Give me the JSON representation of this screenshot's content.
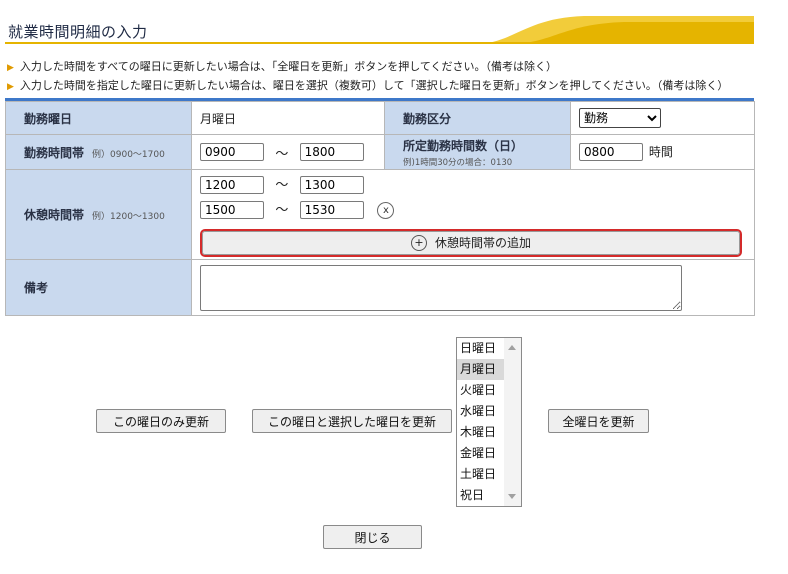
{
  "title": "就業時間明細の入力",
  "notes": [
    "入力した時間をすべての曜日に更新したい場合は、「全曜日を更新」ボタンを押してください。（備考は除く）",
    "入力した時間を指定した曜日に更新したい場合は、曜日を選択（複数可）して「選択した曜日を更新」ボタンを押してください。（備考は除く）"
  ],
  "form": {
    "workday_label": "勤務曜日",
    "workday_value": "月曜日",
    "kubun_label": "勤務区分",
    "kubun_selected": "勤務",
    "worktime_label": "勤務時間帯",
    "worktime_example": "例）0900～1700",
    "worktime_start": "0900",
    "worktime_end": "1800",
    "tilde": "～",
    "prescribed_label": "所定勤務時間数（日）",
    "prescribed_example": "例)1時間30分の場合：0130",
    "prescribed_value": "0800",
    "prescribed_unit": "時間",
    "break_label": "休憩時間帯",
    "break_example": "例）1200～1300",
    "breaks": [
      {
        "start": "1200",
        "end": "1300"
      },
      {
        "start": "1500",
        "end": "1530"
      }
    ],
    "remove_symbol": "x",
    "add_break_label": "休憩時間帯の追加",
    "add_symbol": "+",
    "remarks_label": "備考",
    "remarks_value": ""
  },
  "buttons": {
    "update_this_day": "この曜日のみ更新",
    "update_selected": "この曜日と選択した曜日を更新",
    "update_all": "全曜日を更新",
    "close": "閉じる"
  },
  "weekday_list": {
    "options": [
      "日曜日",
      "月曜日",
      "火曜日",
      "水曜日",
      "木曜日",
      "金曜日",
      "土曜日",
      "祝日"
    ],
    "selected": "月曜日"
  },
  "colors": {
    "label_bg": "#c9d9ee",
    "accent_line": "#3e78c9",
    "title_gold": "#e5b400",
    "highlight_border": "#d42a2a"
  }
}
